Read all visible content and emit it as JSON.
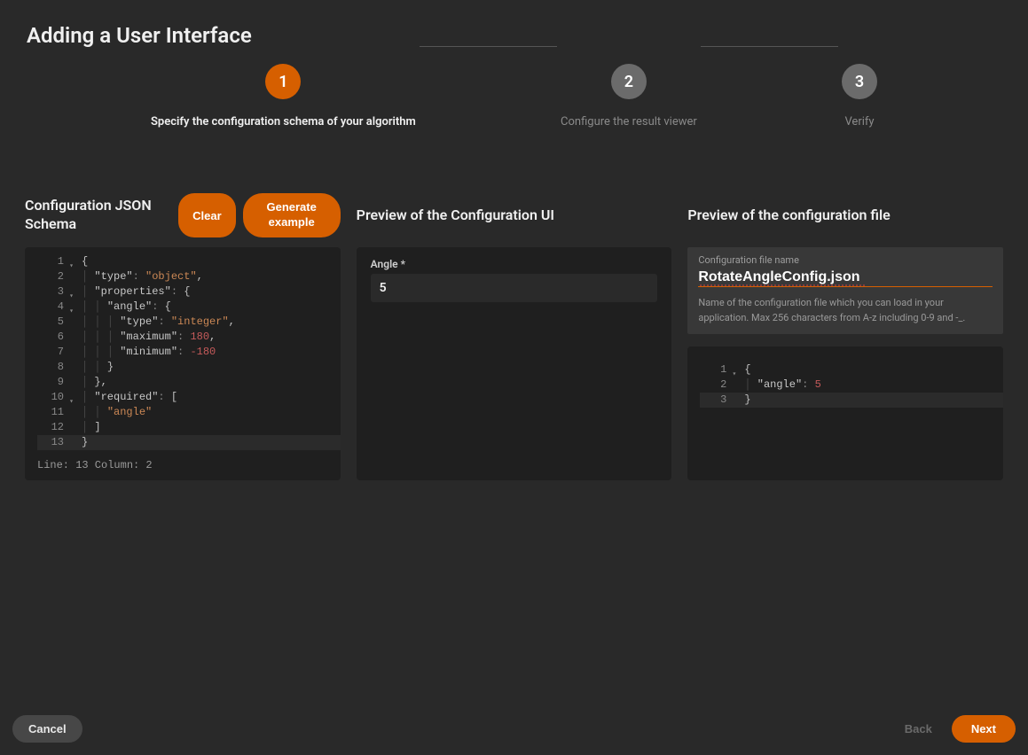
{
  "title": "Adding a User Interface",
  "steps": {
    "s1": {
      "num": "1",
      "label": "Specify the configuration schema of your algorithm"
    },
    "s2": {
      "num": "2",
      "label": "Configure the result viewer"
    },
    "s3": {
      "num": "3",
      "label": "Verify"
    }
  },
  "col1": {
    "title": "Configuration JSON Schema",
    "clear": "Clear",
    "generate_l1": "Generate",
    "generate_l2": "example",
    "lines": {
      "l1": "{",
      "l2": "  ",
      "l3": "  ",
      "l4": "    ",
      "l5": "      ",
      "l6": "      ",
      "l7": "      ",
      "l8": "    }",
      "l9": "  },",
      "l10": "  ",
      "l11": "    ",
      "l12": "  ]",
      "l13": "}"
    },
    "keys": {
      "type": "\"type\"",
      "properties": "\"properties\"",
      "angle_k": "\"angle\"",
      "maximum": "\"maximum\"",
      "minimum": "\"minimum\"",
      "required": "\"required\"",
      "angle_req": "\"angle\""
    },
    "vals": {
      "object": "\"object\"",
      "integer": "\"integer\"",
      "max": "180",
      "min": "-180"
    },
    "status": "Line: 13  Column: 2"
  },
  "col2": {
    "title": "Preview of the Configuration UI",
    "field_label": "Angle *",
    "field_value": "5"
  },
  "col3": {
    "title": "Preview of the configuration file",
    "cfg_label": "Configuration file name",
    "cfg_value": "RotateAngleConfig.json",
    "help": "Name of the configuration file which you can load in your application. Max 256 characters from A-z including 0-9 and -_.",
    "keys": {
      "angle": "\"angle\""
    },
    "vals": {
      "five": "5"
    }
  },
  "footer": {
    "cancel": "Cancel",
    "back": "Back",
    "next": "Next"
  },
  "ln": {
    "n1": "1",
    "n2": "2",
    "n3": "3",
    "n4": "4",
    "n5": "5",
    "n6": "6",
    "n7": "7",
    "n8": "8",
    "n9": "9",
    "n10": "10",
    "n11": "11",
    "n12": "12",
    "n13": "13"
  }
}
